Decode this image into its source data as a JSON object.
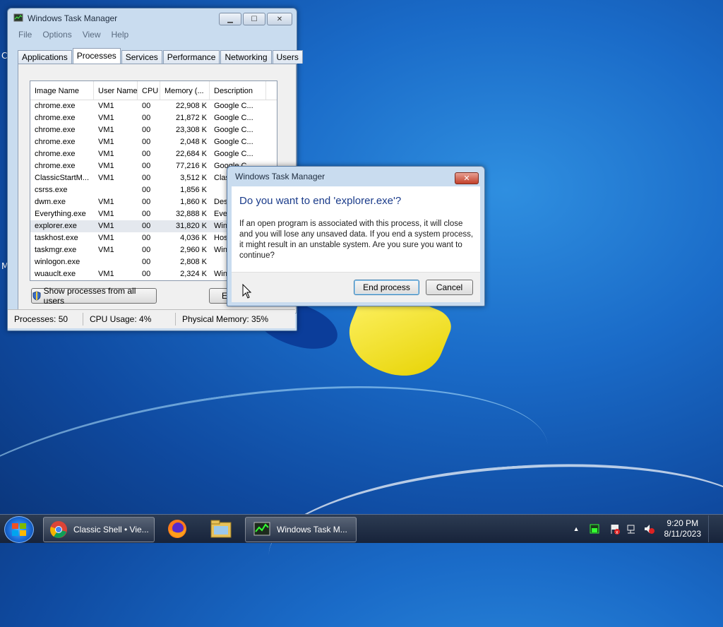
{
  "desktop": {
    "edge_letters": [
      "C",
      "M"
    ]
  },
  "task_manager": {
    "title": "Windows Task Manager",
    "menu": [
      "File",
      "Options",
      "View",
      "Help"
    ],
    "tabs": [
      "Applications",
      "Processes",
      "Services",
      "Performance",
      "Networking",
      "Users"
    ],
    "active_tab": "Processes",
    "columns": [
      "Image Name",
      "User Name",
      "CPU",
      "Memory (...",
      "Description"
    ],
    "rows": [
      {
        "name": "chrome.exe",
        "user": "VM1",
        "cpu": "00",
        "mem": "22,908 K",
        "desc": "Google C..."
      },
      {
        "name": "chrome.exe",
        "user": "VM1",
        "cpu": "00",
        "mem": "21,872 K",
        "desc": "Google C..."
      },
      {
        "name": "chrome.exe",
        "user": "VM1",
        "cpu": "00",
        "mem": "23,308 K",
        "desc": "Google C..."
      },
      {
        "name": "chrome.exe",
        "user": "VM1",
        "cpu": "00",
        "mem": "2,048 K",
        "desc": "Google C..."
      },
      {
        "name": "chrome.exe",
        "user": "VM1",
        "cpu": "00",
        "mem": "22,684 K",
        "desc": "Google C..."
      },
      {
        "name": "chrome.exe",
        "user": "VM1",
        "cpu": "00",
        "mem": "77,216 K",
        "desc": "Google C..."
      },
      {
        "name": "ClassicStartM...",
        "user": "VM1",
        "cpu": "00",
        "mem": "3,512 K",
        "desc": "Clas"
      },
      {
        "name": "csrss.exe",
        "user": "",
        "cpu": "00",
        "mem": "1,856 K",
        "desc": ""
      },
      {
        "name": "dwm.exe",
        "user": "VM1",
        "cpu": "00",
        "mem": "1,860 K",
        "desc": "Desk"
      },
      {
        "name": "Everything.exe",
        "user": "VM1",
        "cpu": "00",
        "mem": "32,888 K",
        "desc": "Ever"
      },
      {
        "name": "explorer.exe",
        "user": "VM1",
        "cpu": "00",
        "mem": "31,820 K",
        "desc": "Win"
      },
      {
        "name": "taskhost.exe",
        "user": "VM1",
        "cpu": "00",
        "mem": "4,036 K",
        "desc": "Host"
      },
      {
        "name": "taskmgr.exe",
        "user": "VM1",
        "cpu": "00",
        "mem": "2,960 K",
        "desc": "Win"
      },
      {
        "name": "winlogon.exe",
        "user": "",
        "cpu": "00",
        "mem": "2,808 K",
        "desc": ""
      },
      {
        "name": "wuauclt.exe",
        "user": "VM1",
        "cpu": "00",
        "mem": "2,324 K",
        "desc": "Win"
      }
    ],
    "show_all_label": "Show processes from all users",
    "end_button_partial": "E",
    "status": {
      "processes": "Processes: 50",
      "cpu": "CPU Usage: 4%",
      "memory": "Physical Memory: 35%"
    }
  },
  "dialog": {
    "title": "Windows Task Manager",
    "heading": "Do you want to end 'explorer.exe'?",
    "message": "If an open program is associated with this process, it will close and you will lose any unsaved data. If you end a system process, it might result in an unstable system. Are you sure you want to continue?",
    "confirm_label": "End process",
    "cancel_label": "Cancel"
  },
  "taskbar": {
    "items": [
      {
        "label": "Classic Shell • Vie...",
        "icon": "chrome-icon"
      },
      {
        "label": "",
        "icon": "firefox-icon"
      },
      {
        "label": "",
        "icon": "folder-icon"
      },
      {
        "label": "Windows Task M...",
        "icon": "task-manager-icon"
      }
    ],
    "time": "9:20 PM",
    "date": "8/11/2023"
  }
}
